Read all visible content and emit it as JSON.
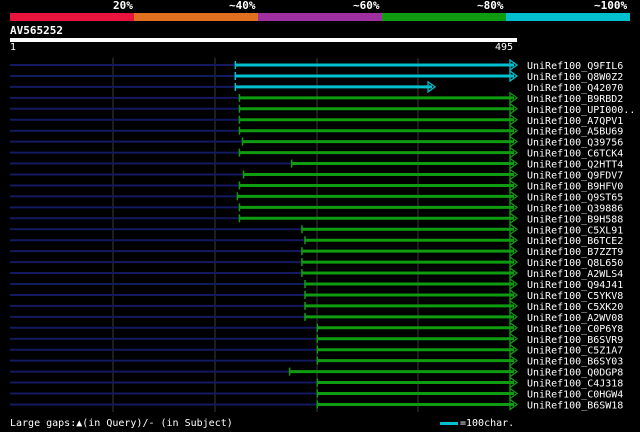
{
  "scale": {
    "labels": [
      "20%",
      "~40%",
      "~60%",
      "~80%",
      "~100%"
    ],
    "colors": [
      "#e8143c",
      "#e07020",
      "#a030a0",
      "#109c10",
      "#00bfcf"
    ]
  },
  "query": {
    "title": "AV565252",
    "start": "1",
    "end": "495",
    "length": 495
  },
  "hits": [
    {
      "name": "UniRef100_Q9FIL6",
      "start": 220,
      "end": 495,
      "color": "#00bfcf"
    },
    {
      "name": "UniRef100_Q8W0Z2",
      "start": 220,
      "end": 495,
      "color": "#00bfcf"
    },
    {
      "name": "UniRef100_Q42070",
      "start": 220,
      "end": 415,
      "color": "#00bfcf"
    },
    {
      "name": "UniRef100_B9RBD2",
      "start": 224,
      "end": 495,
      "color": "#109c10"
    },
    {
      "name": "UniRef100_UPI000..",
      "start": 224,
      "end": 495,
      "color": "#109c10"
    },
    {
      "name": "UniRef100_A7QPV1",
      "start": 224,
      "end": 495,
      "color": "#109c10"
    },
    {
      "name": "UniRef100_A5BU69",
      "start": 224,
      "end": 495,
      "color": "#109c10"
    },
    {
      "name": "UniRef100_Q39756",
      "start": 227,
      "end": 495,
      "color": "#109c10"
    },
    {
      "name": "UniRef100_C6TCK4",
      "start": 224,
      "end": 495,
      "color": "#109c10"
    },
    {
      "name": "UniRef100_Q2HTT4",
      "start": 275,
      "end": 495,
      "color": "#109c10"
    },
    {
      "name": "UniRef100_Q9FDV7",
      "start": 228,
      "end": 495,
      "color": "#109c10"
    },
    {
      "name": "UniRef100_B9HFV0",
      "start": 224,
      "end": 495,
      "color": "#109c10"
    },
    {
      "name": "UniRef100_Q9ST65",
      "start": 222,
      "end": 495,
      "color": "#109c10"
    },
    {
      "name": "UniRef100_Q39886",
      "start": 224,
      "end": 495,
      "color": "#109c10"
    },
    {
      "name": "UniRef100_B9H588",
      "start": 224,
      "end": 495,
      "color": "#109c10"
    },
    {
      "name": "UniRef100_C5XL91",
      "start": 285,
      "end": 495,
      "color": "#109c10"
    },
    {
      "name": "UniRef100_B6TCE2",
      "start": 288,
      "end": 495,
      "color": "#109c10"
    },
    {
      "name": "UniRef100_B7ZZT9",
      "start": 285,
      "end": 495,
      "color": "#109c10"
    },
    {
      "name": "UniRef100_Q8L650",
      "start": 285,
      "end": 495,
      "color": "#109c10"
    },
    {
      "name": "UniRef100_A2WLS4",
      "start": 285,
      "end": 495,
      "color": "#109c10"
    },
    {
      "name": "UniRef100_Q94J41",
      "start": 288,
      "end": 495,
      "color": "#109c10"
    },
    {
      "name": "UniRef100_C5YKV8",
      "start": 288,
      "end": 495,
      "color": "#109c10"
    },
    {
      "name": "UniRef100_C5XK20",
      "start": 288,
      "end": 495,
      "color": "#109c10"
    },
    {
      "name": "UniRef100_A2WV08",
      "start": 288,
      "end": 495,
      "color": "#109c10"
    },
    {
      "name": "UniRef100_C0P6Y8",
      "start": 300,
      "end": 495,
      "color": "#109c10"
    },
    {
      "name": "UniRef100_B6SVR9",
      "start": 300,
      "end": 495,
      "color": "#109c10"
    },
    {
      "name": "UniRef100_C5Z1A7",
      "start": 300,
      "end": 495,
      "color": "#109c10"
    },
    {
      "name": "UniRef100_B6SY03",
      "start": 300,
      "end": 495,
      "color": "#109c10"
    },
    {
      "name": "UniRef100_Q0DGP8",
      "start": 273,
      "end": 495,
      "color": "#109c10"
    },
    {
      "name": "UniRef100_C4J318",
      "start": 300,
      "end": 495,
      "color": "#109c10"
    },
    {
      "name": "UniRef100_C0HGW4",
      "start": 300,
      "end": 495,
      "color": "#109c10"
    },
    {
      "name": "UniRef100_B6SW18",
      "start": 300,
      "end": 495,
      "color": "#109c10"
    }
  ],
  "legend": {
    "text": "Large gaps:▲(in Query)/- (in Subject)"
  },
  "scale_note": {
    "text": "=100char."
  }
}
